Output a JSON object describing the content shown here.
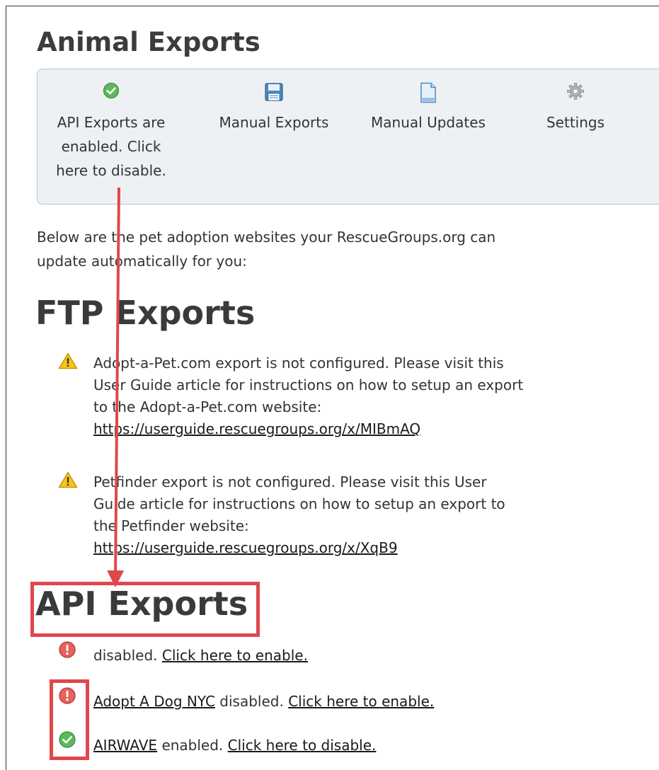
{
  "page": {
    "title": "Animal Exports"
  },
  "toolbar": {
    "items": [
      {
        "label": "API Exports are enabled. Click here to disable.",
        "icon": "check-circle-icon"
      },
      {
        "label": "Manual Exports",
        "icon": "floppy-disk-icon"
      },
      {
        "label": "Manual Updates",
        "icon": "document-icon"
      },
      {
        "label": "Settings",
        "icon": "gear-icon"
      }
    ]
  },
  "intro": {
    "text": "Below are the pet adoption websites your RescueGroups.org can update automatically for you:"
  },
  "ftp": {
    "heading": "FTP Exports",
    "items": [
      {
        "text": "Adopt-a-Pet.com export is not configured. Please visit this User Guide article for instructions on how to setup an export to the Adopt-a-Pet.com website:",
        "link": "https://userguide.rescuegroups.org/x/MIBmAQ",
        "icon": "warning-icon"
      },
      {
        "text": "Petfinder export is not configured. Please visit this User Guide article for instructions on how to setup an export to the Petfinder website:",
        "link": "https://userguide.rescuegroups.org/x/XqB9",
        "icon": "warning-icon"
      }
    ]
  },
  "api": {
    "heading": "API Exports",
    "items": [
      {
        "name": "",
        "status": "disabled.",
        "action": "Click here to enable.",
        "icon": "error-circle-icon"
      },
      {
        "name": "Adopt A Dog NYC",
        "status": "disabled.",
        "action": "Click here to enable.",
        "icon": "error-circle-icon"
      },
      {
        "name": "AIRWAVE",
        "status": "enabled.",
        "action": "Click here to disable.",
        "icon": "check-circle-icon"
      }
    ]
  },
  "colors": {
    "annotation_red": "#e0474c",
    "toolbar_bg": "#eef1f4",
    "enabled_green": "#3aa84a",
    "disabled_red": "#d9534f"
  }
}
